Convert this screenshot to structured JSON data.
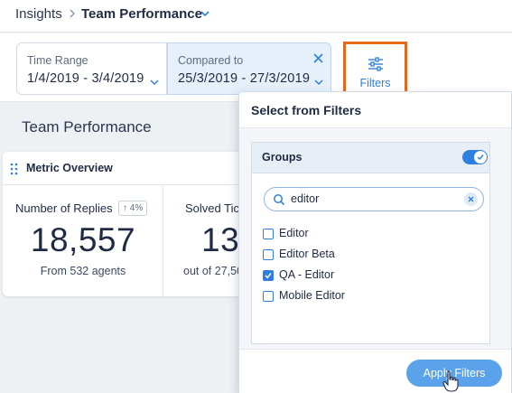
{
  "breadcrumb": {
    "root": "Insights",
    "current": "Team Performance"
  },
  "filter_bar": {
    "time_range": {
      "label": "Time Range",
      "value": "1/4/2019 - 3/4/2019"
    },
    "compared_to": {
      "label": "Compared to",
      "value": "25/3/2019 - 27/3/2019"
    },
    "filters_button": "Filters"
  },
  "page": {
    "title": "Team Performance"
  },
  "metric_card": {
    "title": "Metric Overview",
    "metrics": [
      {
        "label": "Number of Replies",
        "trend": "4%",
        "value": "18,557",
        "sub": "From 532 agents"
      },
      {
        "label": "Solved Tic",
        "value": "13,",
        "sub": "out of 27,50"
      }
    ]
  },
  "filter_panel": {
    "title": "Select from Filters",
    "group": {
      "title": "Groups",
      "toggle_on": true,
      "search_value": "editor",
      "options": [
        {
          "label": "Editor",
          "checked": false
        },
        {
          "label": "Editor Beta",
          "checked": false
        },
        {
          "label": "QA - Editor",
          "checked": true
        },
        {
          "label": "Mobile Editor",
          "checked": false
        }
      ]
    },
    "apply_label": "Apply Filters"
  },
  "colors": {
    "accent": "#2f7fe0",
    "highlight_border": "#e26a1c",
    "apply_button": "#5aa2ea",
    "compare_bg": "#e6f0fb"
  }
}
